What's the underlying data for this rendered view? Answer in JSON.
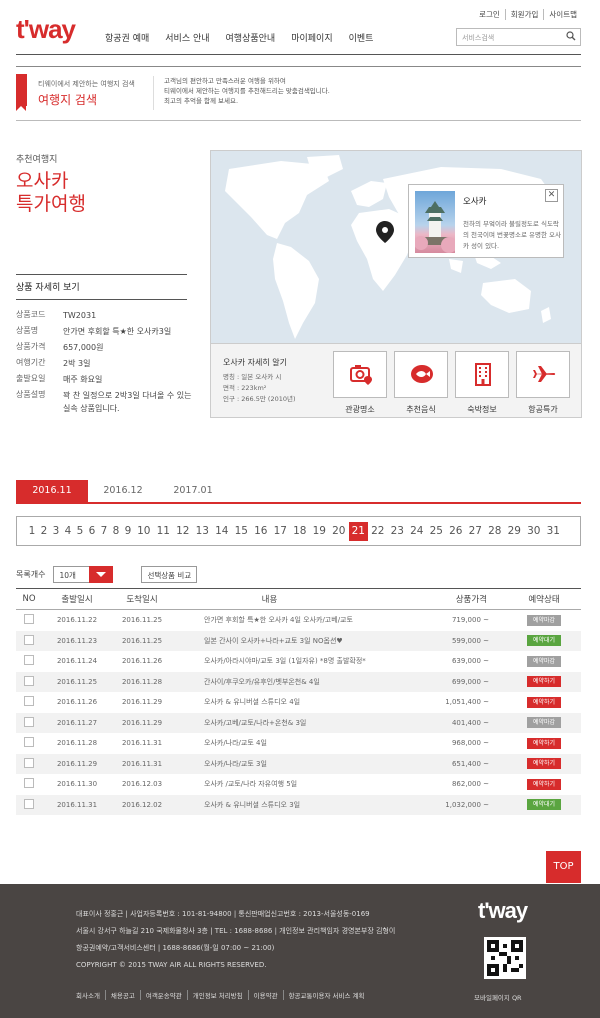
{
  "header": {
    "logo": "t'way",
    "top_links": [
      "로그인",
      "회원가입",
      "사이트맵"
    ],
    "nav": [
      "항공권 예매",
      "서비스 안내",
      "여행상품안내",
      "마이페이지",
      "이벤트"
    ],
    "search_placeholder": "서비스검색"
  },
  "banner": {
    "subtitle": "티웨이에서 제안하는 여행지 검색",
    "title": "여행지 검색",
    "desc": [
      "고객님의 편안하고 만족스러운 여행을 위하여",
      "티웨이에서 제안하는 여행지를 추천해드리는 맞춤검색입니다.",
      "최고의 추억을 함께 보세요."
    ]
  },
  "product": {
    "section_label": "추천여행지",
    "title": "오사카\n특가여행",
    "detail_heading": "상품 자세히 보기",
    "rows": [
      {
        "key": "상품코드",
        "value": "TW2031"
      },
      {
        "key": "상품명",
        "value": "안가면 후회할 특★한 오사카3일"
      },
      {
        "key": "상품가격",
        "value": "657,000원"
      },
      {
        "key": "여행기간",
        "value": "2박 3일"
      },
      {
        "key": "출발요일",
        "value": "매주 화요일"
      },
      {
        "key": "상품설명",
        "value": "꽉 찬 일정으로 2박3일 다녀올 수 있는 실속 상품입니다."
      }
    ]
  },
  "map": {
    "popup_title": "오사카",
    "popup_desc": "천하의 부엌이라 불릴정도로 식도락의 천국이며 번꽃명소로 유명한 오사카 성이 있다.",
    "close_label": "✕",
    "info_title": "오사카 자세히 알기",
    "info_lines": [
      "명칭 : 일본 오사카 시",
      "면적 : 223km²",
      "인구 : 266.5만 (2010년)"
    ],
    "categories": [
      {
        "label": "관광명소",
        "icon": "camera-pin-icon"
      },
      {
        "label": "추천음식",
        "icon": "fish-plate-icon"
      },
      {
        "label": "숙박정보",
        "icon": "building-icon"
      },
      {
        "label": "항공특가",
        "icon": "airplane-icon"
      }
    ]
  },
  "month_tabs": [
    "2016.11",
    "2016.12",
    "2017.01"
  ],
  "active_month": "2016.11",
  "days": [
    "1",
    "2",
    "3",
    "4",
    "5",
    "6",
    "7",
    "8",
    "9",
    "10",
    "11",
    "12",
    "13",
    "14",
    "15",
    "16",
    "17",
    "18",
    "19",
    "20",
    "21",
    "22",
    "23",
    "24",
    "25",
    "26",
    "27",
    "28",
    "29",
    "30",
    "31"
  ],
  "active_day": "21",
  "list": {
    "count_label": "목록개수",
    "count_value": "10개",
    "compare_label": "선택상품 비교",
    "headers": [
      "NO",
      "출발일시",
      "도착일시",
      "내용",
      "상품가격",
      "예약상태"
    ],
    "rows": [
      {
        "dep": "2016.11.22",
        "arr": "2016.11.25",
        "content": "안가면 후회할 특★한 오사카 4일 오사카/고베/교토",
        "price": "719,000 ~",
        "status": "예약마감",
        "type": "close"
      },
      {
        "dep": "2016.11.23",
        "arr": "2016.11.25",
        "content": "일본 간사이 오사카+나라+교토 3일 NO옵션♥",
        "price": "599,000 ~",
        "status": "예약대기",
        "type": "wait"
      },
      {
        "dep": "2016.11.24",
        "arr": "2016.11.26",
        "content": "오사카/아라시야마/교토 3일 (1일자유) *8명 출발확정*",
        "price": "639,000 ~",
        "status": "예약마감",
        "type": "close"
      },
      {
        "dep": "2016.11.25",
        "arr": "2016.11.28",
        "content": "간사이/후쿠오카/유후인/벳부온천& 4일",
        "price": "699,000 ~",
        "status": "예약하기",
        "type": "book"
      },
      {
        "dep": "2016.11.26",
        "arr": "2016.11.29",
        "content": "오사카 & 유니버셜 스튜디오 4일",
        "price": "1,051,400 ~",
        "status": "예약하기",
        "type": "book"
      },
      {
        "dep": "2016.11.27",
        "arr": "2016.11.29",
        "content": "오사카/고베/교토/나라+온천& 3일",
        "price": "401,400 ~",
        "status": "예약마감",
        "type": "close"
      },
      {
        "dep": "2016.11.28",
        "arr": "2016.11.31",
        "content": "오사카/나라/교토 4일",
        "price": "968,000 ~",
        "status": "예약하기",
        "type": "book"
      },
      {
        "dep": "2016.11.29",
        "arr": "2016.11.31",
        "content": "오사카/나라/교토 3일",
        "price": "651,400 ~",
        "status": "예약하기",
        "type": "book"
      },
      {
        "dep": "2016.11.30",
        "arr": "2016.12.03",
        "content": "오사카 /교토/나라 자유여행 5일",
        "price": "862,000 ~",
        "status": "예약하기",
        "type": "book"
      },
      {
        "dep": "2016.11.31",
        "arr": "2016.12.02",
        "content": "오사카 & 유니버셜 스튜디오 3일",
        "price": "1,032,000 ~",
        "status": "예약대기",
        "type": "wait"
      }
    ]
  },
  "top_button": "TOP",
  "footer": {
    "lines": [
      "대표이사 정홍근 | 사업자등록번호 : 101-81-94800 | 통신판매업신고번호 : 2013-서울성동-0169",
      "서울시 강서구 하늘길 210 국제화물청사 3층 | TEL : 1688-8686 | 개인정보 관리책임자 경영본부장 김형이",
      "항공권예약/고객서비스센터 | 1688-8686(월-일 07:00 ~ 21:00)",
      "COPYRIGHT © 2015 TWAY AIR ALL RIGHTS RESERVED."
    ],
    "links": [
      "회사소개",
      "채용공고",
      "여객운송약관",
      "개인정보 처리방침",
      "이용약관",
      "항공교통이용자 서비스 계획"
    ],
    "logo": "t'way",
    "qr_label": "모바일페이지 QR"
  },
  "colors": {
    "accent": "#d72c2c",
    "footer_bg": "#4a4543",
    "map_sea": "#dce6ee",
    "map_land": "#ffffff",
    "wait": "#5aa540",
    "closed": "#a0a0a0"
  }
}
